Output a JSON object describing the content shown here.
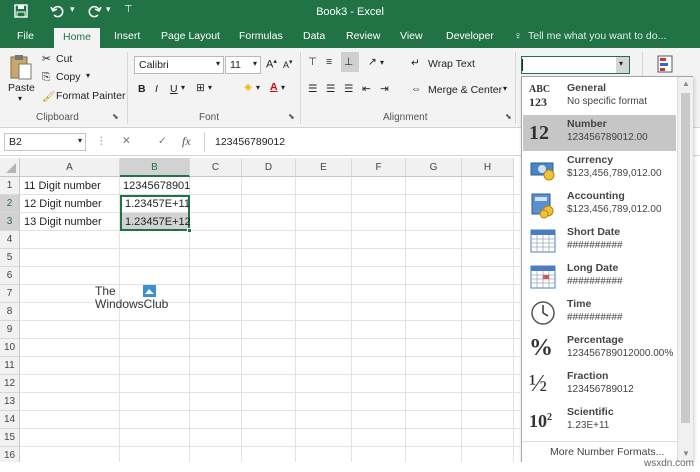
{
  "window": {
    "title": "Book3 - Excel"
  },
  "quick_access": [
    "save-icon",
    "undo-icon",
    "redo-icon",
    "customize-icon"
  ],
  "tabs": [
    {
      "label": "File"
    },
    {
      "label": "Home"
    },
    {
      "label": "Insert"
    },
    {
      "label": "Page Layout"
    },
    {
      "label": "Formulas"
    },
    {
      "label": "Data"
    },
    {
      "label": "Review"
    },
    {
      "label": "View"
    },
    {
      "label": "Developer"
    }
  ],
  "tell_me": "Tell me what you want to do...",
  "ribbon": {
    "clipboard": {
      "paste": "Paste",
      "cut": "Cut",
      "copy": "Copy",
      "format_painter": "Format Painter",
      "label": "Clipboard"
    },
    "font": {
      "name": "Calibri",
      "size": "11",
      "label": "Font",
      "bold": "B",
      "italic": "I",
      "underline": "U"
    },
    "alignment": {
      "wrap_text": "Wrap Text",
      "merge_center": "Merge & Center",
      "label": "Alignment"
    },
    "number": {
      "format_value": ""
    }
  },
  "formula_bar": {
    "name_box": "B2",
    "fx": "fx",
    "content": "123456789012"
  },
  "sheet": {
    "columns": [
      "A",
      "B",
      "C",
      "D",
      "E",
      "F",
      "G",
      "H"
    ],
    "rows": [
      "1",
      "2",
      "3",
      "4",
      "5",
      "6",
      "7",
      "8",
      "9",
      "10",
      "11",
      "12",
      "13",
      "14",
      "15",
      "16"
    ],
    "cells": {
      "A1": "11 Digit number",
      "B1": "12345678901",
      "A2": "12 Digit number",
      "B2": "1.23457E+11",
      "A3": "13 Digit number",
      "B3": "1.23457E+12"
    },
    "watermark": [
      "The",
      "WindowsClub"
    ]
  },
  "number_formats": [
    {
      "name": "General",
      "example": "No specific format",
      "icon": "general-icon"
    },
    {
      "name": "Number",
      "example": "123456789012.00",
      "icon": "number-icon"
    },
    {
      "name": "Currency",
      "example": "$123,456,789,012.00",
      "icon": "currency-icon"
    },
    {
      "name": "Accounting",
      "example": "$123,456,789,012.00",
      "icon": "accounting-icon"
    },
    {
      "name": "Short Date",
      "example": "##########",
      "icon": "calendar-icon"
    },
    {
      "name": "Long Date",
      "example": "##########",
      "icon": "calendar-icon"
    },
    {
      "name": "Time",
      "example": "##########",
      "icon": "clock-icon"
    },
    {
      "name": "Percentage",
      "example": "123456789012000.00%",
      "icon": "percent-icon"
    },
    {
      "name": "Fraction",
      "example": "123456789012",
      "icon": "fraction-icon"
    },
    {
      "name": "Scientific",
      "example": "1.23E+11",
      "icon": "scientific-icon"
    }
  ],
  "icon_labels": {
    "general": [
      "ABC",
      "123"
    ],
    "number": "12",
    "percent": "%",
    "fraction": "½",
    "scientific": "10",
    "scientific_exp": "2"
  },
  "more_formats": "More Number Formats...",
  "watermark_site": "wsxdn.com",
  "colors": {
    "excel_green": "#217346",
    "selection": "#c6c6c6"
  }
}
